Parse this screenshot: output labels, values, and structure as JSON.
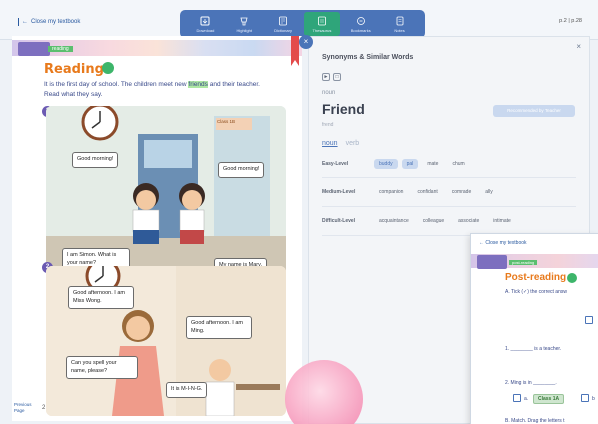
{
  "topbar": {
    "close_label": "Close my textbook",
    "page_indicator": "p.2 | p.28"
  },
  "toolbar": {
    "tools": [
      {
        "label": "Download",
        "icon": "download-icon"
      },
      {
        "label": "Highlight",
        "icon": "highlight-icon"
      },
      {
        "label": "Dictionary",
        "icon": "dictionary-icon"
      },
      {
        "label": "Thesaurus",
        "icon": "thesaurus-icon",
        "active": true
      },
      {
        "label": "Bookmarks",
        "icon": "bookmark-icon"
      },
      {
        "label": "Notes",
        "icon": "notes-icon"
      }
    ]
  },
  "book": {
    "section_tag": "reading",
    "heading": "Reading",
    "intro_before": "It is the first day of school. The children meet new",
    "intro_highlight": "friends",
    "intro_after": "and their teacher. Read what they say.",
    "scene1": {
      "number": "1",
      "class_sign": "Class 1B",
      "bubbles": [
        "Good morning!",
        "Good morning!",
        "I am Simon. What is your name?",
        "My name is Mary."
      ]
    },
    "scene2": {
      "number": "2",
      "bubbles": [
        "Good afternoon. I am Miss Wong.",
        "Good afternoon. I am Ming.",
        "Can you spell your name, please?",
        "It is M-I-N-G."
      ]
    },
    "prev_page": "Previous Page",
    "page_number": "2"
  },
  "dictionary": {
    "title": "Synonyms & Similar Words",
    "part_of_speech": "noun",
    "word": "Friend",
    "phonetic": "frend",
    "recommended": "Recommended by Teacher",
    "tabs": [
      "noun",
      "verb"
    ],
    "levels": [
      {
        "name": "Easy-Level",
        "words": [
          "buddy",
          "pal",
          "mate",
          "chum"
        ],
        "active": [
          0,
          1
        ]
      },
      {
        "name": "Medium-Level",
        "words": [
          "companion",
          "confidant",
          "comrade",
          "ally"
        ],
        "active": []
      },
      {
        "name": "Difficult-Level",
        "words": [
          "acquaintance",
          "colleague",
          "associate",
          "intimate"
        ],
        "active": []
      }
    ]
  },
  "window2": {
    "close_label": "Close my textbook",
    "section_tag": "post-reading",
    "heading": "Post-reading",
    "instr_a": "A. Tick (✓) the correct answ",
    "q1": "1. ________ is a teacher.",
    "q2": "2. Ming is in ________.",
    "option_a_prefix": "a.",
    "option_a": "Class 1A",
    "option_b_prefix": "b",
    "instr_b": "B. Match. Drag the letters t"
  }
}
